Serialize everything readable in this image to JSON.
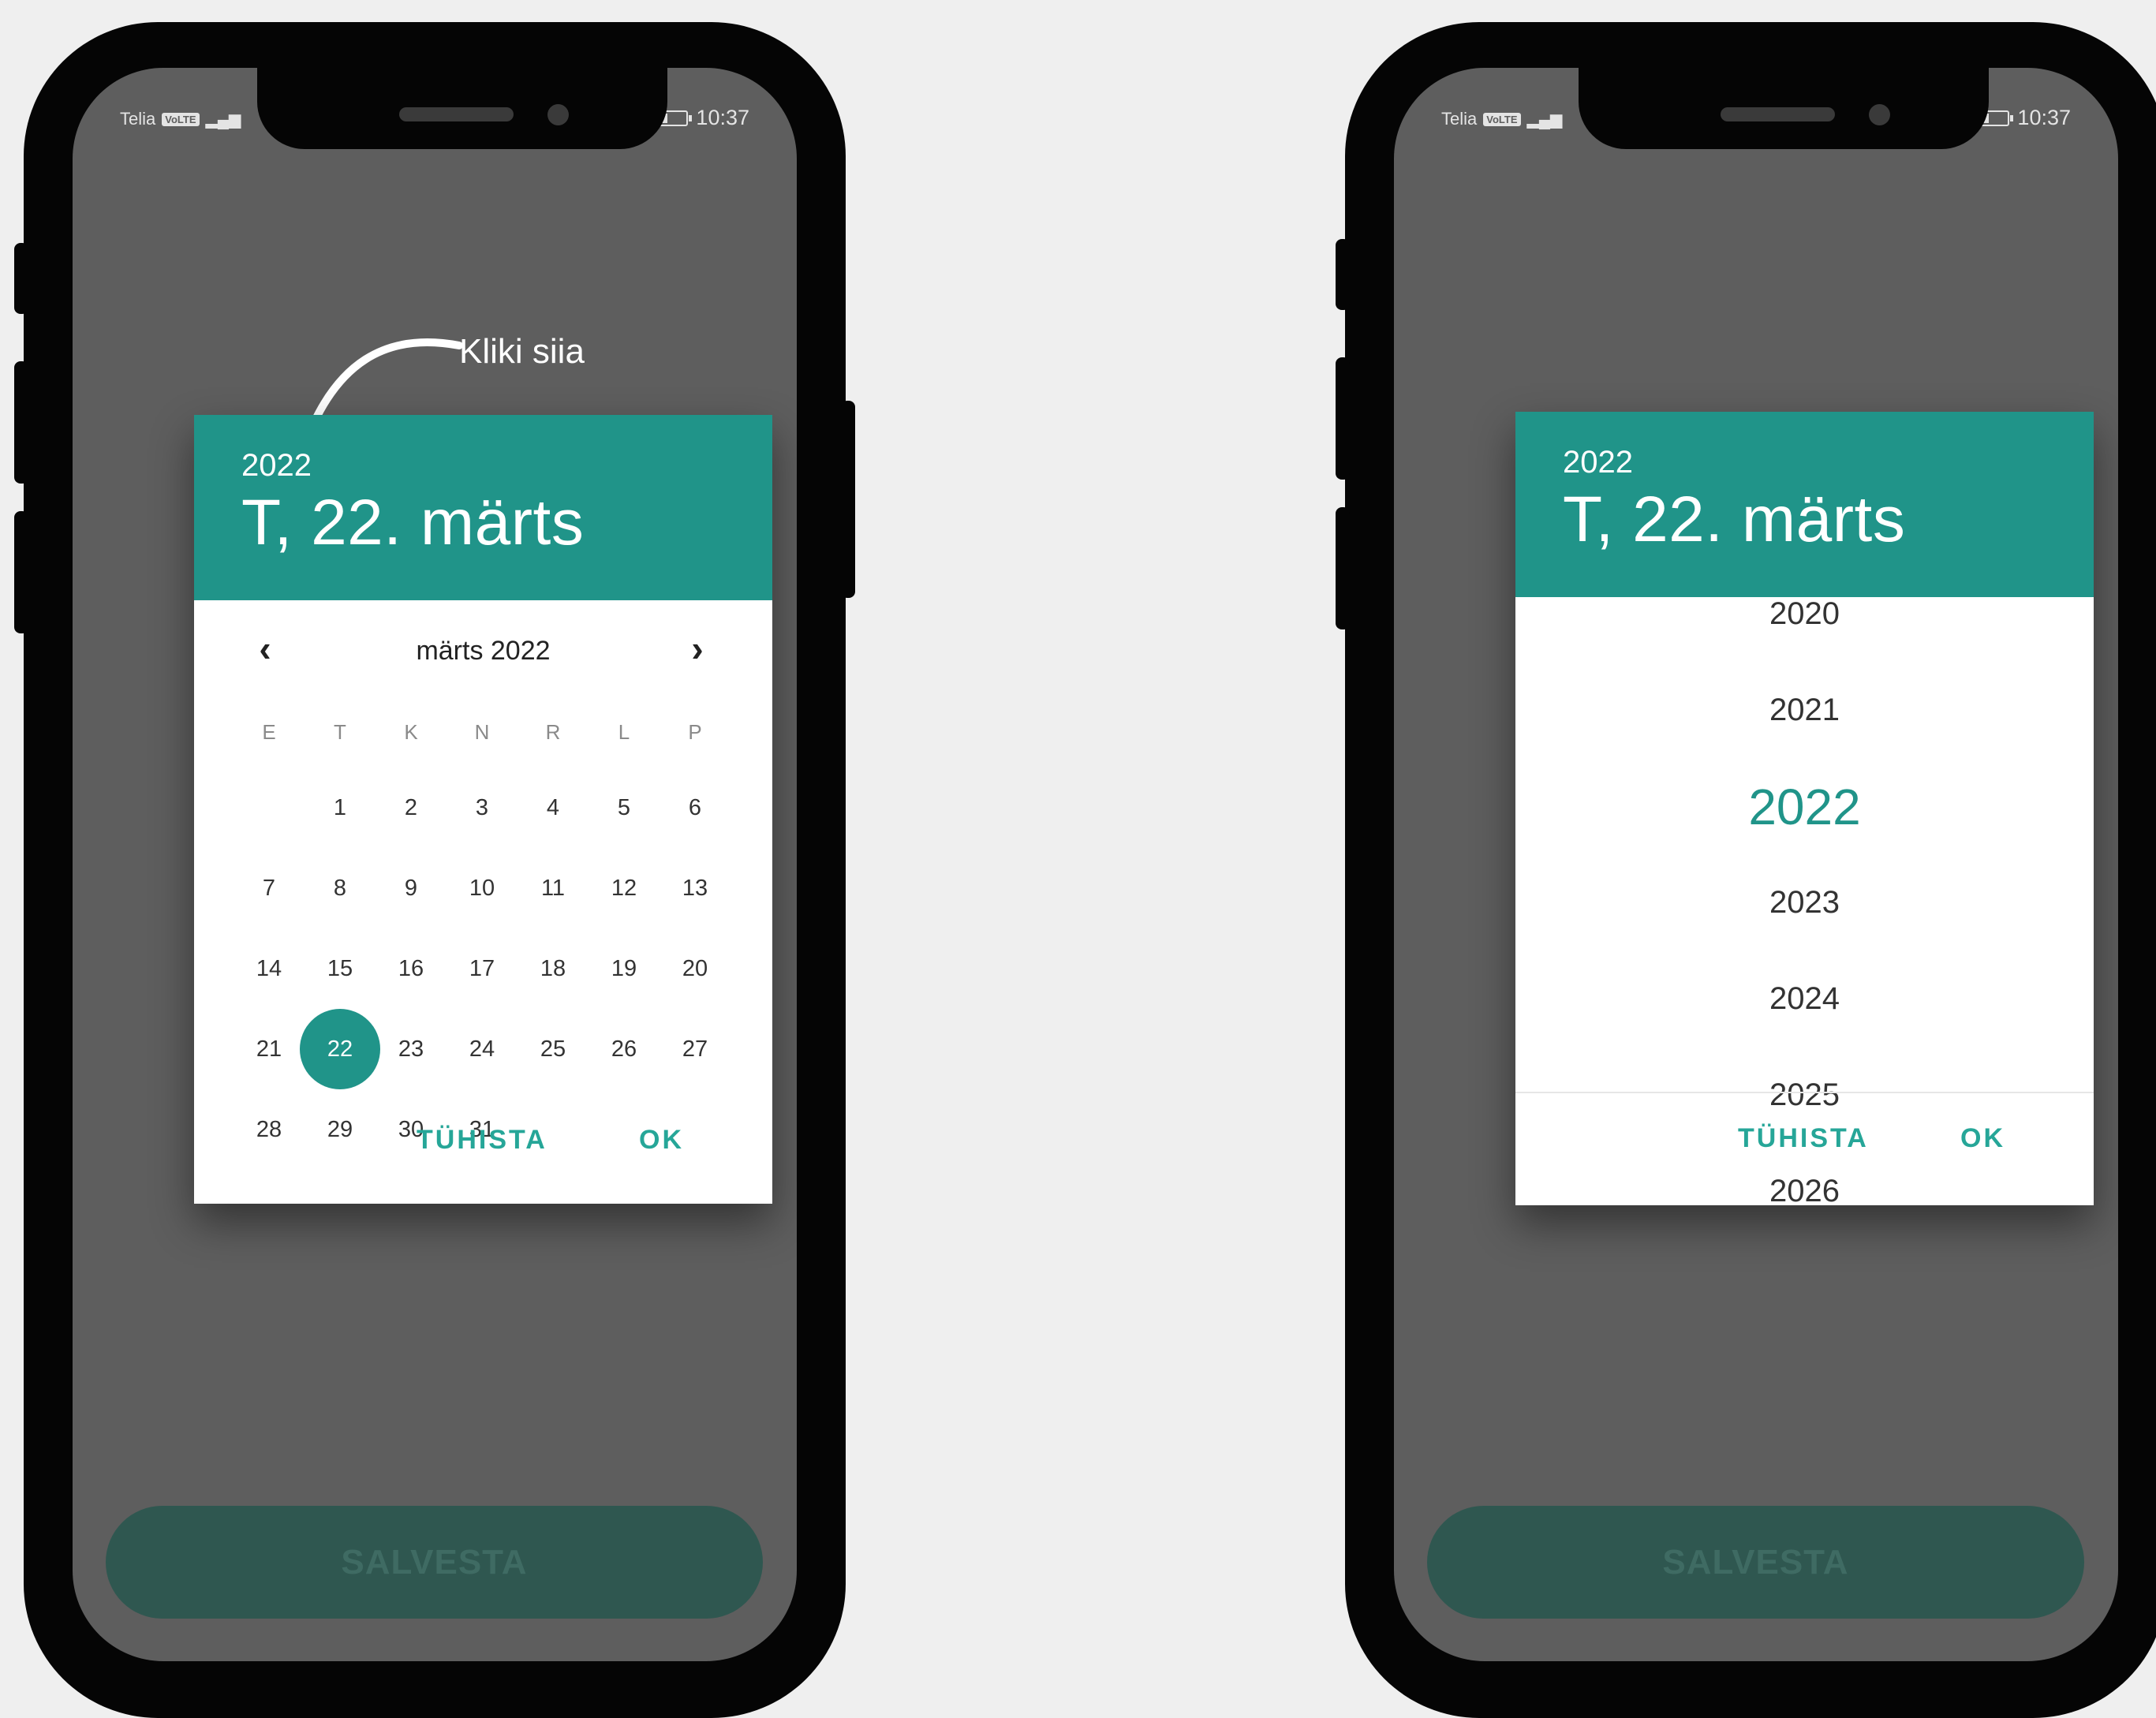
{
  "status_bar": {
    "carrier": "Telia",
    "network_badge": "VoLTE",
    "time": "10:37"
  },
  "annotation": {
    "text": "Kliki siia"
  },
  "date_picker_left": {
    "header_year": "2022",
    "header_date": "T, 22. märts",
    "month_label": "märts 2022",
    "prev_icon": "chevron-left-icon",
    "next_icon": "chevron-right-icon",
    "weekdays": [
      "E",
      "T",
      "K",
      "N",
      "R",
      "L",
      "P"
    ],
    "days": [
      "1",
      "2",
      "3",
      "4",
      "5",
      "6",
      "7",
      "8",
      "9",
      "10",
      "11",
      "12",
      "13",
      "14",
      "15",
      "16",
      "17",
      "18",
      "19",
      "20",
      "21",
      "22",
      "23",
      "24",
      "25",
      "26",
      "27",
      "28",
      "29",
      "30",
      "31"
    ],
    "selected_day": "22",
    "cancel_label": "TÜHISTA",
    "ok_label": "OK"
  },
  "date_picker_right": {
    "header_year": "2022",
    "header_date": "T, 22. märts",
    "years": [
      "2020",
      "2021",
      "2022",
      "2023",
      "2024",
      "2025",
      "2026"
    ],
    "selected_year": "2022",
    "cancel_label": "TÜHISTA",
    "ok_label": "OK"
  },
  "save_button": {
    "label": "SALVESTA"
  },
  "colors": {
    "accent": "#209489",
    "action_text": "#26a698",
    "overlay": "#5e5e5e",
    "save_button_bg": "#2f5750"
  }
}
